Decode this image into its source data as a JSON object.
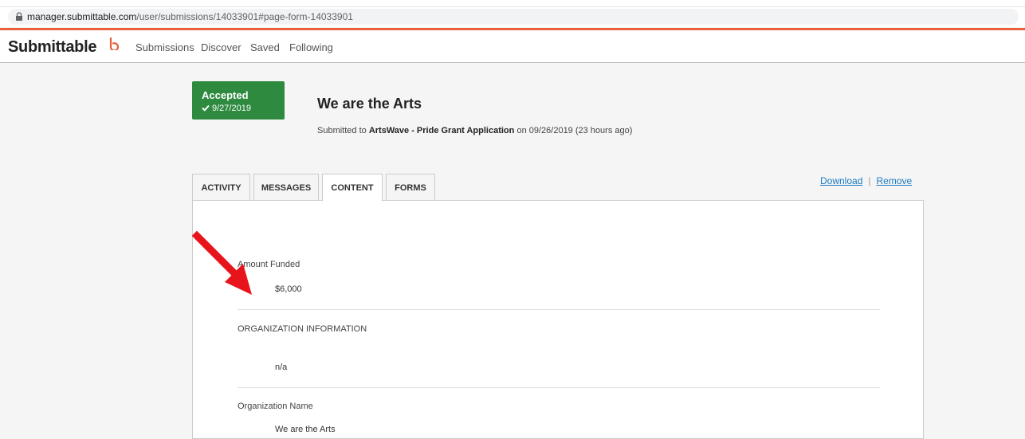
{
  "browser": {
    "url_domain": "manager.submittable.com",
    "url_path": "/user/submissions/14033901#page-form-14033901",
    "lock_icon": "lock-icon"
  },
  "colors": {
    "accent": "#e8603c",
    "accepted": "#2d8a3e",
    "link": "#1a7ac0",
    "arrow": "#e8141b"
  },
  "nav": {
    "brand": "Submittable",
    "items": [
      "Submissions",
      "Discover",
      "Saved",
      "Following"
    ]
  },
  "submission": {
    "status": "Accepted",
    "status_date": "9/27/2019",
    "title": "We are the Arts",
    "submitted_prefix": "Submitted to",
    "form_name": "ArtsWave - Pride Grant Application",
    "submitted_suffix": "on 09/26/2019 (23 hours ago)"
  },
  "tabs": [
    "ACTIVITY",
    "MESSAGES",
    "CONTENT",
    "FORMS"
  ],
  "active_tab": "CONTENT",
  "actions": {
    "download": "Download",
    "separator": "|",
    "remove": "Remove"
  },
  "fields": [
    {
      "label": "Amount Funded",
      "value": "$6,000"
    },
    {
      "label": "ORGANIZATION INFORMATION",
      "value": "n/a"
    },
    {
      "label": "Organization Name",
      "value": "We are the Arts"
    }
  ]
}
